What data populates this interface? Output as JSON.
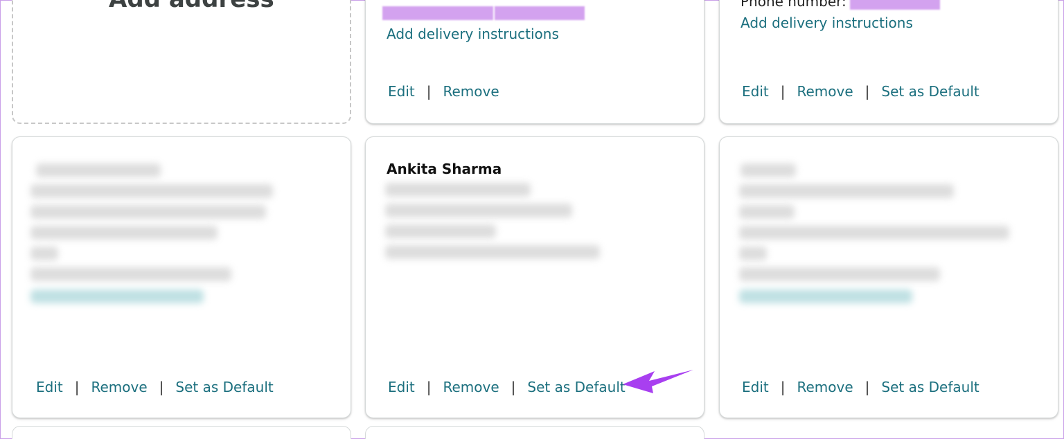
{
  "add_card": {
    "title": "Add address"
  },
  "cards": [
    {
      "id": "top-middle",
      "delivery_link": "Add delivery instructions",
      "actions": [
        "Edit",
        "Remove"
      ]
    },
    {
      "id": "top-right",
      "phone_label": "Phone number:",
      "delivery_link": "Add delivery instructions",
      "actions": [
        "Edit",
        "Remove",
        "Set as Default"
      ]
    },
    {
      "id": "bottom-left",
      "actions": [
        "Edit",
        "Remove",
        "Set as Default"
      ]
    },
    {
      "id": "bottom-middle",
      "name": "Ankita Sharma",
      "actions": [
        "Edit",
        "Remove",
        "Set as Default"
      ]
    },
    {
      "id": "bottom-right",
      "actions": [
        "Edit",
        "Remove",
        "Set as Default"
      ]
    }
  ],
  "separator": "|",
  "colors": {
    "link": "#1b6f7e",
    "annotation_arrow": "#a83ff0",
    "redaction": "#cf99ee"
  }
}
